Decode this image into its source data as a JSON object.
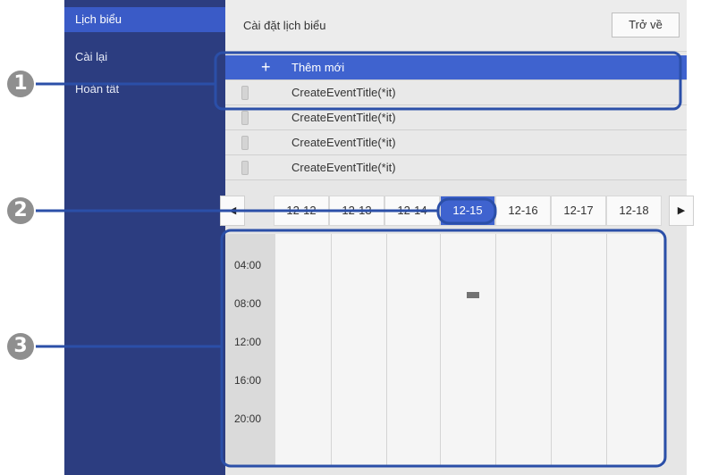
{
  "sidebar": {
    "items": [
      {
        "label": "Lịch biểu",
        "active": true
      },
      {
        "label": "Cài lại",
        "active": false
      },
      {
        "label": "Hoàn tất",
        "active": false
      }
    ]
  },
  "header": {
    "title": "Cài đặt lịch biểu",
    "back_label": "Trở về"
  },
  "events": {
    "add_label": "Thêm mới",
    "add_icon": "plus-icon",
    "items": [
      {
        "title": "CreateEventTitle(*it)"
      },
      {
        "title": "CreateEventTitle(*it)"
      },
      {
        "title": "CreateEventTitle(*it)"
      },
      {
        "title": "CreateEventTitle(*it)"
      }
    ]
  },
  "dates": {
    "prev_icon": "left-arrow-icon",
    "next_icon": "right-arrow-icon",
    "tabs": [
      {
        "label": "12-12"
      },
      {
        "label": "12-13"
      },
      {
        "label": "12-14"
      },
      {
        "label": "12-15",
        "selected": true
      },
      {
        "label": "12-16"
      },
      {
        "label": "12-17"
      },
      {
        "label": "12-18"
      }
    ]
  },
  "timeline": {
    "times": [
      "04:00",
      "08:00",
      "12:00",
      "16:00",
      "20:00"
    ]
  },
  "callouts": [
    "1",
    "2",
    "3"
  ],
  "colors": {
    "sidebar_bg": "#2c3d80",
    "accent": "#3f63cf",
    "callout_outline": "#2b4fa8",
    "callout_badge": "#8f8f8f"
  }
}
